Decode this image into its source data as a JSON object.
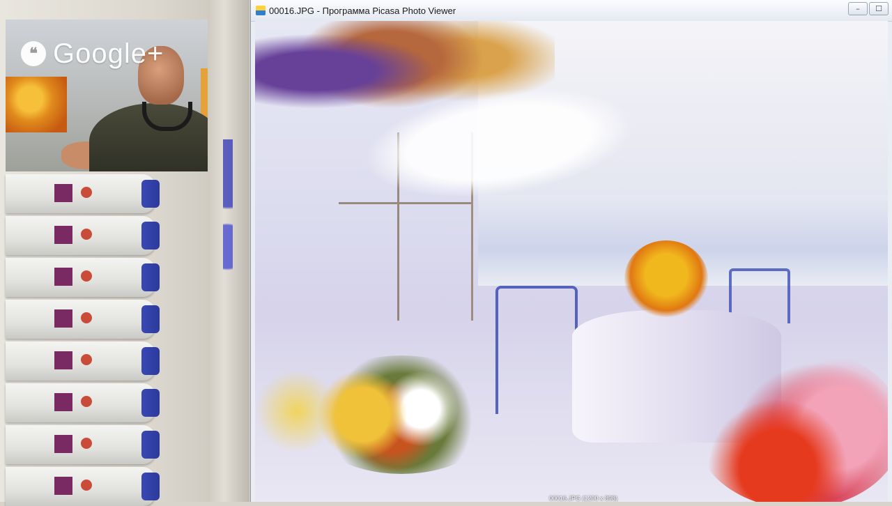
{
  "overlay": {
    "brand_icon": "google-plus-bubble-icon",
    "brand_text": "Google+"
  },
  "window": {
    "title": "00016.JPG - Программа Picasa Photo Viewer",
    "app_icon": "picasa-icon",
    "controls": {
      "minimize": "–",
      "maximize": "☐",
      "close": "×"
    }
  },
  "viewer": {
    "caption": "00016.JPG (1200 x 898)",
    "filmstrip_colors": [
      "#4f8ad1",
      "#c9a552",
      "#7fb6e0",
      "#e0c84a",
      "#3f9a5a",
      "#d9b07a",
      "#6e8fc4",
      "#c94b3a",
      "#e5d36c",
      "#4a7ab8",
      "#9bc46a",
      "#d9d06a",
      "#2f7fd1",
      "#c07a3a",
      "#7ac0c9",
      "#e0a0b0",
      "#5a9a4a",
      "#e6c24a",
      "#8a6ac9",
      "#3a8ad0"
    ],
    "current_index": 1
  }
}
